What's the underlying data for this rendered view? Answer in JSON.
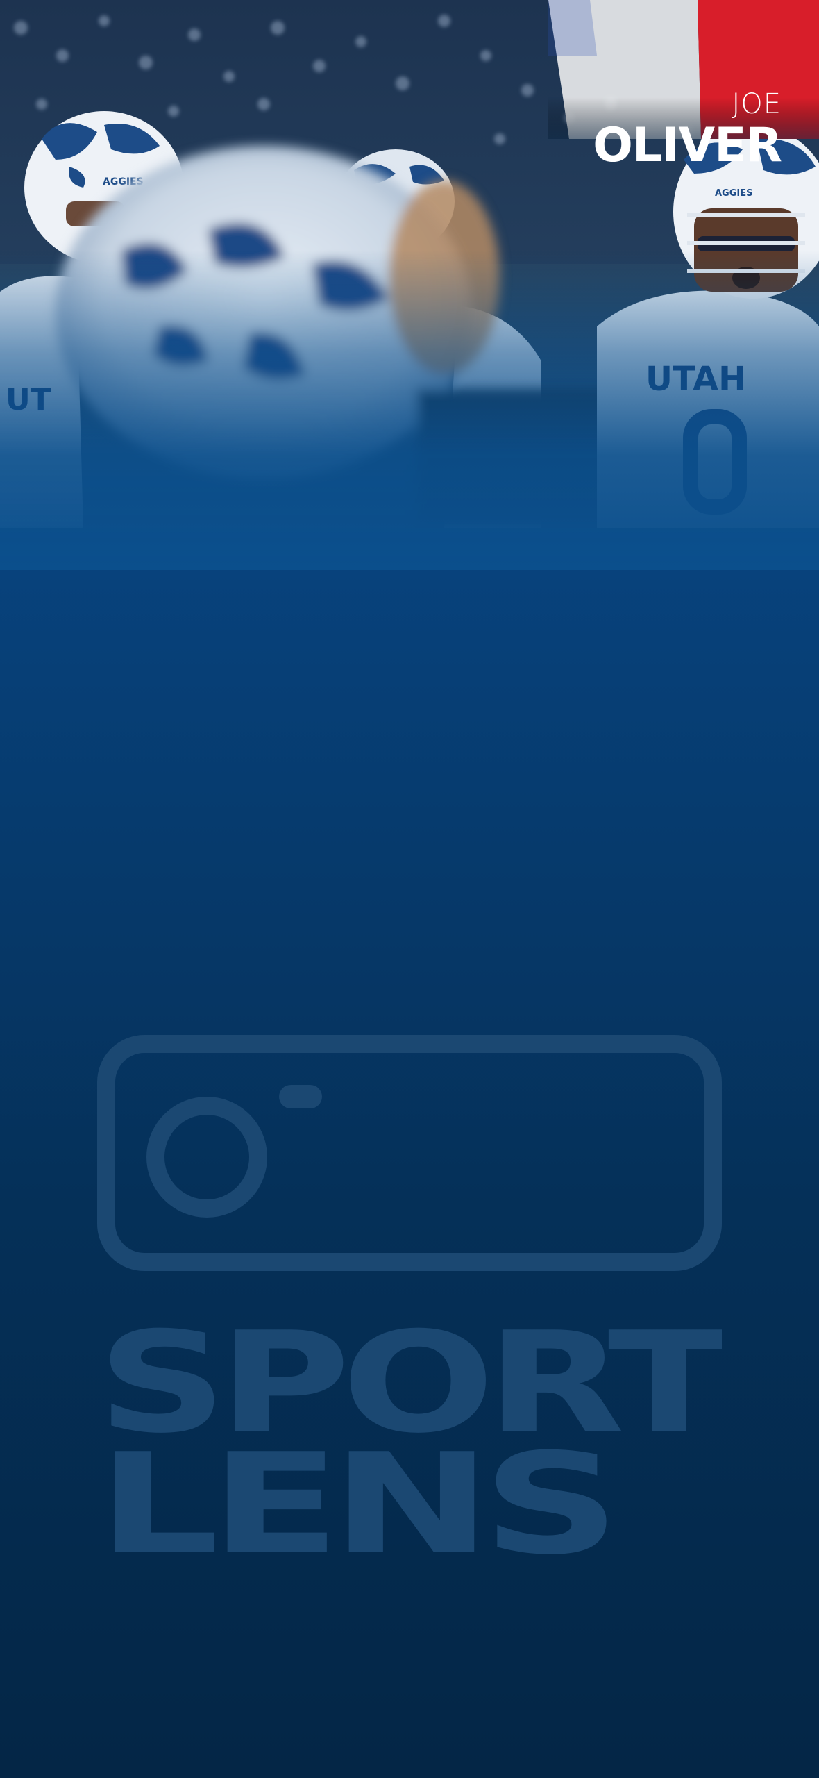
{
  "player": {
    "first_name": "JOE",
    "last_name": "OLIVER"
  },
  "hero": {
    "jersey_text": "UTAH",
    "helmet_logo": "AGGIES",
    "description_icon": "team-huddle-photo"
  },
  "branding": {
    "logo_icon": "camera-outline-icon",
    "wordmark": "SPORT LENS"
  },
  "colors": {
    "background_top": "#0b4f8c",
    "background_bottom": "#042646",
    "watermark": "#1b4872",
    "flag_blue": "#2b4fb3",
    "flag_white": "#f2f2f2",
    "flag_red": "#d81e2a"
  }
}
